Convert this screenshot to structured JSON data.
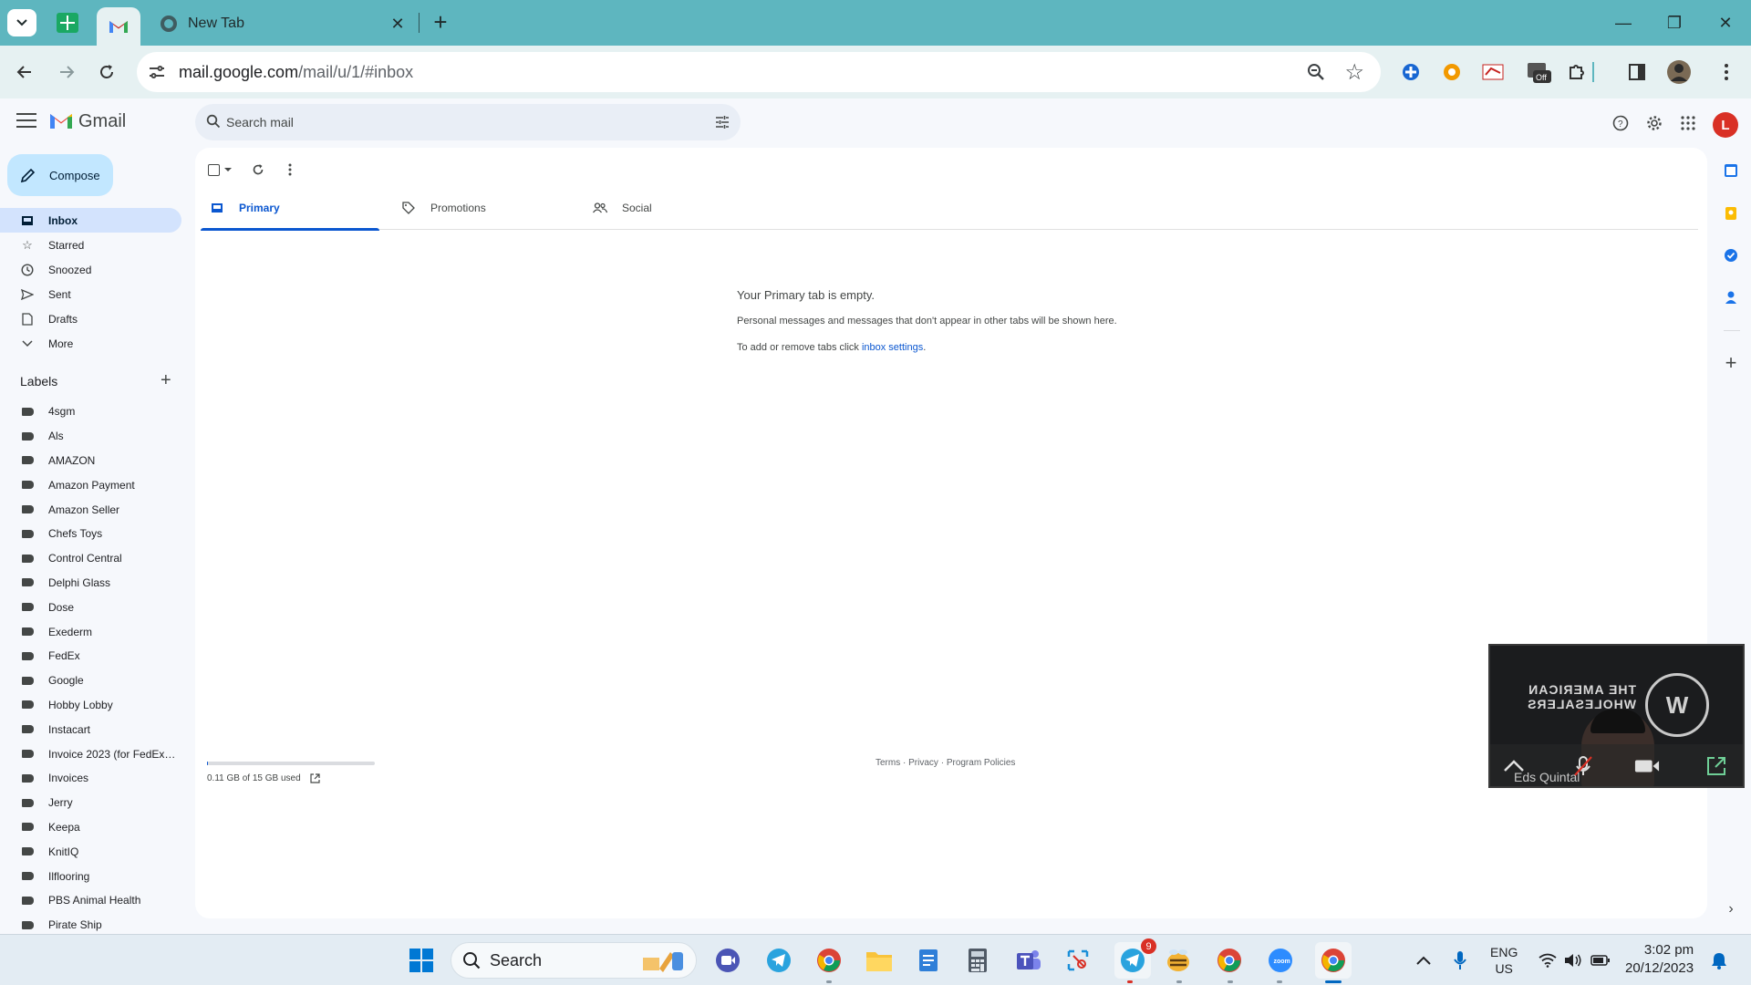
{
  "browser": {
    "tabs": [
      {
        "label": "",
        "icon": "gmail-icon"
      },
      {
        "label": "New Tab",
        "icon": "chrome-icon"
      }
    ],
    "new_tab_label": "+",
    "close_label": "✕",
    "url_host": "mail.google.com",
    "url_path": "/mail/u/1/#inbox",
    "window_controls": {
      "minimize": "—",
      "maximize": "❐",
      "close": "✕"
    }
  },
  "gmail": {
    "app_name": "Gmail",
    "search_placeholder": "Search mail",
    "avatar_letter": "L",
    "compose_label": "Compose",
    "nav": [
      {
        "label": "Inbox",
        "icon": "inbox-icon",
        "active": true
      },
      {
        "label": "Starred",
        "icon": "star-icon"
      },
      {
        "label": "Snoozed",
        "icon": "clock-icon"
      },
      {
        "label": "Sent",
        "icon": "send-icon"
      },
      {
        "label": "Drafts",
        "icon": "draft-icon"
      },
      {
        "label": "More",
        "icon": "chevron-down-icon"
      }
    ],
    "labels_heading": "Labels",
    "labels": [
      "4sgm",
      "Als",
      "AMAZON",
      "Amazon Payment",
      "Amazon Seller",
      "Chefs Toys",
      "Control Central",
      "Delphi Glass",
      "Dose",
      "Exederm",
      "FedEx",
      "Google",
      "Hobby Lobby",
      "Instacart",
      "Invoice 2023 (for FedEx ...",
      "Invoices",
      "Jerry",
      "Keepa",
      "KnitIQ",
      "Ilflooring",
      "PBS Animal Health",
      "Pirate Ship"
    ],
    "category_tabs": [
      {
        "label": "Primary",
        "icon": "inbox-icon",
        "active": true
      },
      {
        "label": "Promotions",
        "icon": "tag-icon"
      },
      {
        "label": "Social",
        "icon": "people-icon"
      }
    ],
    "empty_state": {
      "title": "Your Primary tab is empty.",
      "description": "Personal messages and messages that don't appear in other tabs will be shown here.",
      "hint_prefix": "To add or remove tabs click ",
      "hint_link": "inbox settings",
      "hint_suffix": "."
    },
    "storage": {
      "text": "0.11 GB of 15 GB used",
      "fraction_used": 0.007
    },
    "footer": {
      "terms": "Terms",
      "privacy": "Privacy",
      "policies": "Program Policies",
      "separator": " · "
    }
  },
  "video_call": {
    "participant_name": "Eds Quintal",
    "sign_text": "THE AMERICAN WHOLESALERS",
    "logo_text": "W"
  },
  "taskbar": {
    "search_label": "Search",
    "telegram_badge": "9",
    "language": "ENG",
    "region": "US",
    "time": "3:02 pm",
    "date": "20/12/2023"
  },
  "colors": {
    "tab_bar": "#5eb6bf",
    "toolbar": "#e6f1f2",
    "compose": "#c2e7ff",
    "active_nav": "#d3e3fd",
    "accent": "#0b57d0",
    "avatar": "#d93025"
  }
}
